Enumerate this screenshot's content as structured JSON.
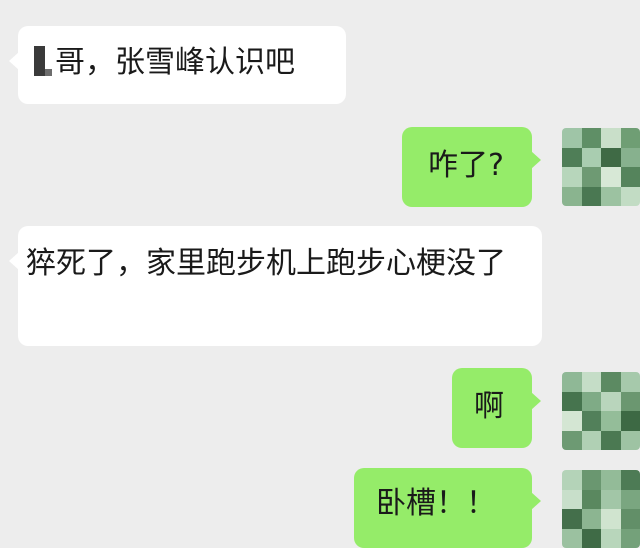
{
  "conversation": {
    "messages": [
      {
        "side": "left",
        "text": "哥，张雪峰认识吧"
      },
      {
        "side": "right",
        "text": "咋了?"
      },
      {
        "side": "left",
        "text": "猝死了，家里跑步机上跑步心梗没了"
      },
      {
        "side": "right",
        "text": "啊"
      },
      {
        "side": "right",
        "text": "卧槽！！"
      }
    ]
  },
  "avatar_icon": "pixelated-avatar-icon",
  "colors": {
    "background": "#ededed",
    "received_bubble": "#ffffff",
    "sent_bubble": "#95ec69"
  }
}
